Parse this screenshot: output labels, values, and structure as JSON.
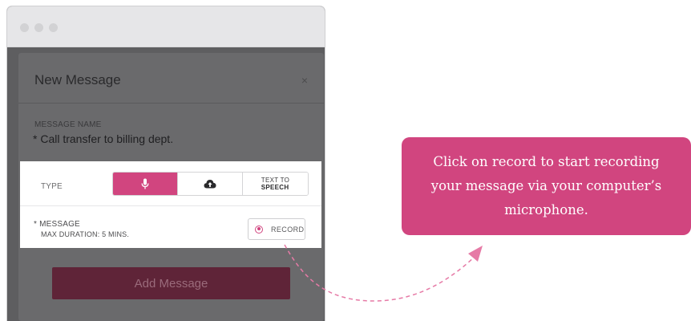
{
  "modal": {
    "title": "New Message",
    "close_symbol": "×",
    "message_name_caption": "MESSAGE NAME",
    "message_name_value": "* Call transfer to billing dept.",
    "add_button_label": "Add Message"
  },
  "panel": {
    "type_label": "TYPE",
    "type_options": [
      {
        "name": "microphone",
        "icon": "microphone-icon",
        "active": true
      },
      {
        "name": "upload",
        "icon": "cloud-upload-icon",
        "active": false
      },
      {
        "name": "text-to-speech",
        "label_top": "TEXT TO",
        "label_bottom": "SPEECH",
        "active": false
      }
    ],
    "message_label": "* MESSAGE",
    "max_duration": "MAX DURATION: 5 MINS.",
    "record_label": "RECORD"
  },
  "tooltip": {
    "text": "Click on record to start recording your message via your computer’s microphone."
  },
  "colors": {
    "accent": "#d1457f",
    "button_dim": "#5f2438",
    "overlay": "#5e5e60"
  }
}
